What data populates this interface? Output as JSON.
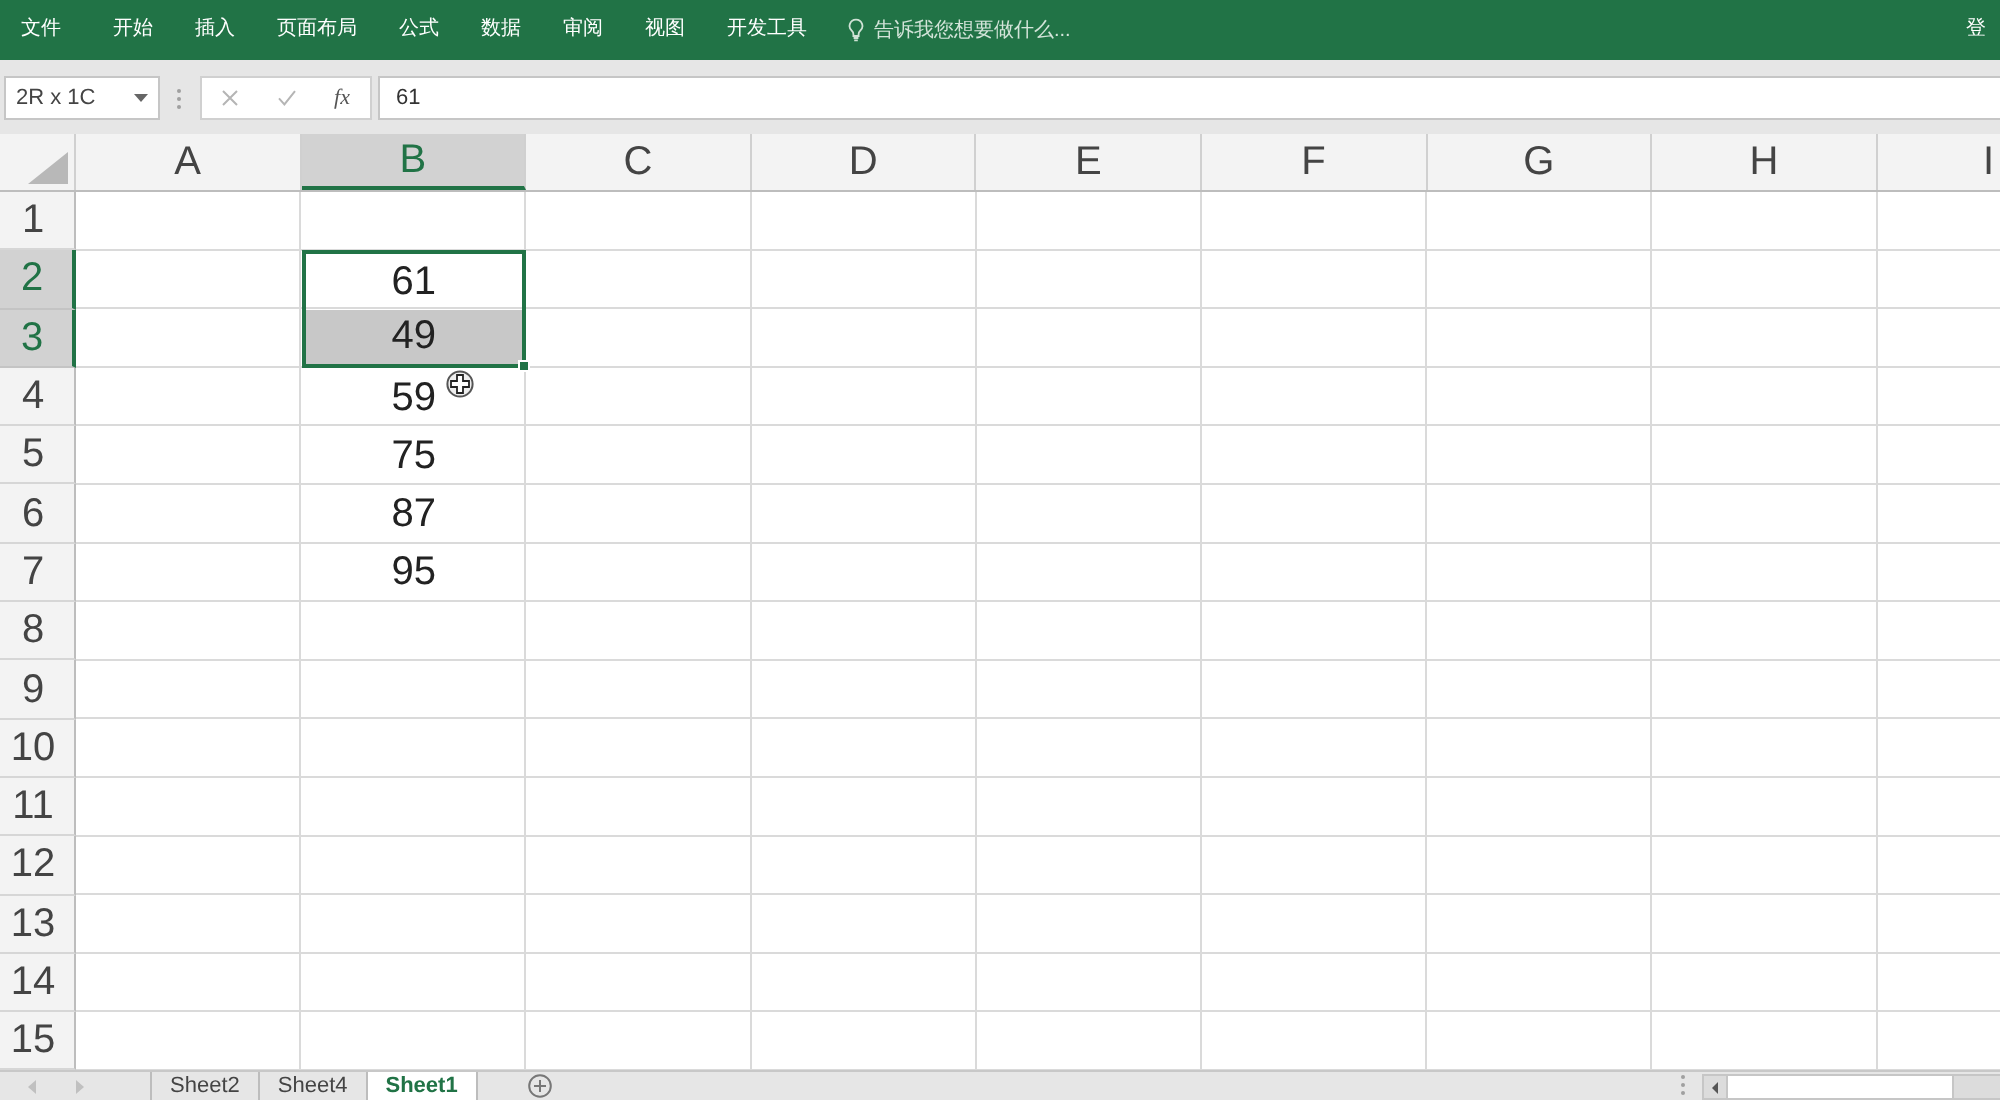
{
  "ribbon": {
    "tabs": [
      {
        "label": "文件",
        "selected": false
      },
      {
        "label": "开始",
        "selected": false
      },
      {
        "label": "插入",
        "selected": false
      },
      {
        "label": "页面布局",
        "selected": false
      },
      {
        "label": "公式",
        "selected": false
      },
      {
        "label": "数据",
        "selected": false
      },
      {
        "label": "审阅",
        "selected": false
      },
      {
        "label": "视图",
        "selected": false
      },
      {
        "label": "开发工具",
        "selected": false
      }
    ],
    "tell_me": {
      "placeholder": "告诉我您想要做什么..."
    },
    "sign_in": "登"
  },
  "formula_bar": {
    "name_box": "2R x 1C",
    "function_button": "fx",
    "formula": "61"
  },
  "columns": [
    {
      "label": "A",
      "selected": false
    },
    {
      "label": "B",
      "selected": true
    },
    {
      "label": "C",
      "selected": false
    },
    {
      "label": "D",
      "selected": false
    },
    {
      "label": "E",
      "selected": false
    },
    {
      "label": "F",
      "selected": false
    },
    {
      "label": "G",
      "selected": false
    },
    {
      "label": "H",
      "selected": false
    },
    {
      "label": "I",
      "selected": false
    }
  ],
  "rows": [
    {
      "label": "1",
      "selected": false
    },
    {
      "label": "2",
      "selected": true,
      "column_b": {
        "value": "61",
        "selected": true,
        "active": true
      }
    },
    {
      "label": "3",
      "selected": true,
      "column_b": {
        "value": "49",
        "selected": true,
        "active": false
      }
    },
    {
      "label": "4",
      "selected": false,
      "column_b": {
        "value": "59",
        "selected": false,
        "active": false
      }
    },
    {
      "label": "5",
      "selected": false,
      "column_b": {
        "value": "75",
        "selected": false,
        "active": false
      }
    },
    {
      "label": "6",
      "selected": false,
      "column_b": {
        "value": "87",
        "selected": false,
        "active": false
      }
    },
    {
      "label": "7",
      "selected": false,
      "column_b": {
        "value": "95",
        "selected": false,
        "active": false
      }
    },
    {
      "label": "8",
      "selected": false
    },
    {
      "label": "9",
      "selected": false
    },
    {
      "label": "10",
      "selected": false
    },
    {
      "label": "11",
      "selected": false
    },
    {
      "label": "12",
      "selected": false
    },
    {
      "label": "13",
      "selected": false
    },
    {
      "label": "14",
      "selected": false
    },
    {
      "label": "15",
      "selected": false
    }
  ],
  "sheet_tabs": [
    {
      "label": "Sheet2",
      "selected": false
    },
    {
      "label": "Sheet4",
      "selected": false
    },
    {
      "label": "Sheet1",
      "selected": true
    }
  ]
}
